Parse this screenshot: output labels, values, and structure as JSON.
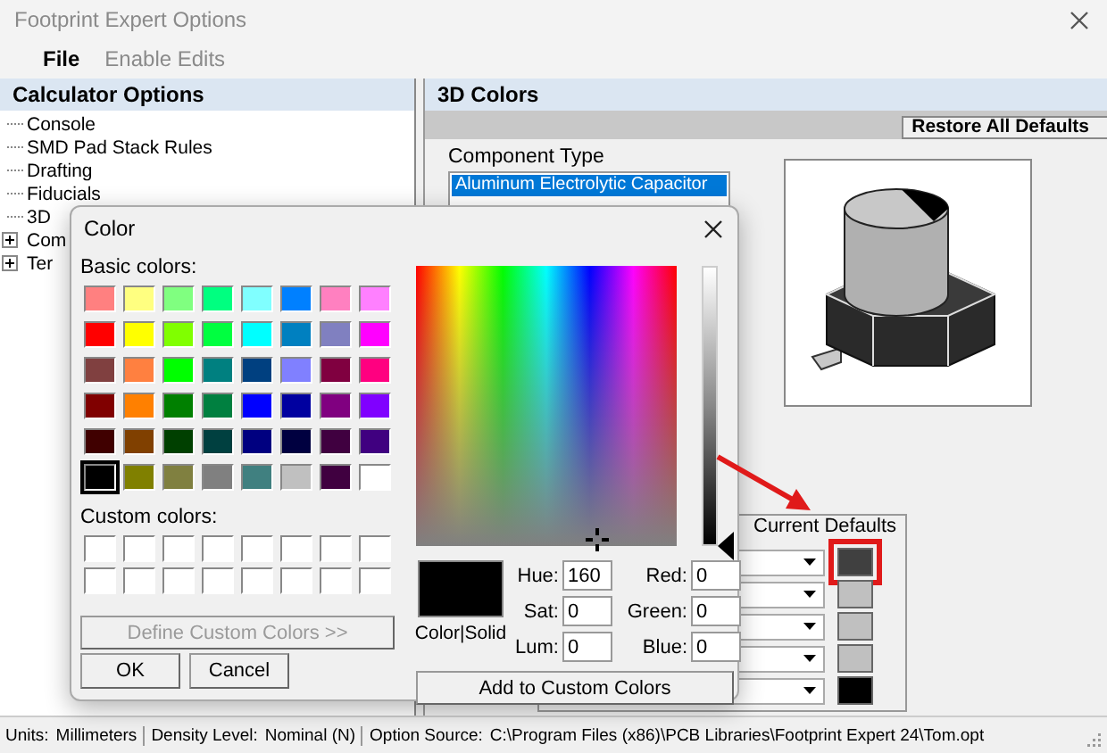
{
  "window": {
    "title": "Footprint Expert Options"
  },
  "menu": [
    {
      "label": "File",
      "disabled": false
    },
    {
      "label": "Enable Edits",
      "disabled": true
    }
  ],
  "sidebar": {
    "title": "Calculator Options",
    "items": [
      {
        "label": "Console",
        "kind": "leaf"
      },
      {
        "label": "SMD Pad Stack Rules",
        "kind": "leaf"
      },
      {
        "label": "Drafting",
        "kind": "leaf"
      },
      {
        "label": "Fiducials",
        "kind": "leaf"
      },
      {
        "label": "3D",
        "kind": "leaf"
      },
      {
        "label": "Com",
        "kind": "node"
      },
      {
        "label": "Ter",
        "kind": "node"
      }
    ]
  },
  "panel": {
    "title": "3D Colors",
    "restore_button": "Restore All Defaults",
    "component_type": {
      "label": "Component Type",
      "items": [
        {
          "label": "Aluminum Electrolytic Capacitor",
          "selected": true
        }
      ]
    },
    "color_table": {
      "columns": [
        "Current",
        "Defaults"
      ],
      "rows": [
        {
          "color": "#404040",
          "highlighted": true
        },
        {
          "color": "#c0c0c0",
          "highlighted": false
        },
        {
          "color": "#c0c0c0",
          "highlighted": false
        },
        {
          "color": "#c0c0c0",
          "highlighted": false
        },
        {
          "color": "#000000",
          "highlighted": false
        }
      ]
    }
  },
  "dialog": {
    "title": "Color",
    "basic_label": "Basic colors:",
    "basic_colors": [
      {
        "color": "#ff8080",
        "selected": false
      },
      {
        "color": "#ffff80",
        "selected": false
      },
      {
        "color": "#80ff80",
        "selected": false
      },
      {
        "color": "#00ff80",
        "selected": false
      },
      {
        "color": "#80ffff",
        "selected": false
      },
      {
        "color": "#0080ff",
        "selected": false
      },
      {
        "color": "#ff80c0",
        "selected": false
      },
      {
        "color": "#ff80ff",
        "selected": false
      },
      {
        "color": "#ff0000",
        "selected": false
      },
      {
        "color": "#ffff00",
        "selected": false
      },
      {
        "color": "#80ff00",
        "selected": false
      },
      {
        "color": "#00ff40",
        "selected": false
      },
      {
        "color": "#00ffff",
        "selected": false
      },
      {
        "color": "#0080c0",
        "selected": false
      },
      {
        "color": "#8080c0",
        "selected": false
      },
      {
        "color": "#ff00ff",
        "selected": false
      },
      {
        "color": "#804040",
        "selected": false
      },
      {
        "color": "#ff8040",
        "selected": false
      },
      {
        "color": "#00ff00",
        "selected": false
      },
      {
        "color": "#008080",
        "selected": false
      },
      {
        "color": "#004080",
        "selected": false
      },
      {
        "color": "#8080ff",
        "selected": false
      },
      {
        "color": "#800040",
        "selected": false
      },
      {
        "color": "#ff0080",
        "selected": false
      },
      {
        "color": "#800000",
        "selected": false
      },
      {
        "color": "#ff8000",
        "selected": false
      },
      {
        "color": "#008000",
        "selected": false
      },
      {
        "color": "#008040",
        "selected": false
      },
      {
        "color": "#0000ff",
        "selected": false
      },
      {
        "color": "#0000a0",
        "selected": false
      },
      {
        "color": "#800080",
        "selected": false
      },
      {
        "color": "#8000ff",
        "selected": false
      },
      {
        "color": "#400000",
        "selected": false
      },
      {
        "color": "#804000",
        "selected": false
      },
      {
        "color": "#004000",
        "selected": false
      },
      {
        "color": "#004040",
        "selected": false
      },
      {
        "color": "#000080",
        "selected": false
      },
      {
        "color": "#000040",
        "selected": false
      },
      {
        "color": "#400040",
        "selected": false
      },
      {
        "color": "#400080",
        "selected": false
      },
      {
        "color": "#000000",
        "selected": true
      },
      {
        "color": "#808000",
        "selected": false
      },
      {
        "color": "#808040",
        "selected": false
      },
      {
        "color": "#808080",
        "selected": false
      },
      {
        "color": "#408080",
        "selected": false
      },
      {
        "color": "#c0c0c0",
        "selected": false
      },
      {
        "color": "#400040",
        "selected": false
      },
      {
        "color": "#ffffff",
        "selected": false
      }
    ],
    "custom_label": "Custom colors:",
    "custom_colors": [
      {
        "color": "#ffffff"
      },
      {
        "color": "#ffffff"
      },
      {
        "color": "#ffffff"
      },
      {
        "color": "#ffffff"
      },
      {
        "color": "#ffffff"
      },
      {
        "color": "#ffffff"
      },
      {
        "color": "#ffffff"
      },
      {
        "color": "#ffffff"
      },
      {
        "color": "#ffffff"
      },
      {
        "color": "#ffffff"
      },
      {
        "color": "#ffffff"
      },
      {
        "color": "#ffffff"
      },
      {
        "color": "#ffffff"
      },
      {
        "color": "#ffffff"
      },
      {
        "color": "#ffffff"
      },
      {
        "color": "#ffffff"
      }
    ],
    "define_button": {
      "label": "Define Custom Colors >>",
      "disabled": true
    },
    "ok_button": "OK",
    "cancel_button": "Cancel",
    "luminance": {
      "level": 0
    },
    "preview": {
      "color": "#000000",
      "label": "Color|Solid"
    },
    "fields": [
      {
        "label": "Hue:",
        "value": "160"
      },
      {
        "label": "Red:",
        "value": "0"
      },
      {
        "label": "Sat:",
        "value": "0"
      },
      {
        "label": "Green:",
        "value": "0"
      },
      {
        "label": "Lum:",
        "value": "0"
      },
      {
        "label": "Blue:",
        "value": "0"
      }
    ],
    "add_button": "Add to Custom Colors"
  },
  "status_bar": [
    {
      "label": "Units:",
      "value": "Millimeters"
    },
    {
      "label": "Density Level:",
      "value": "Nominal (N)"
    },
    {
      "label": "Option Source:",
      "value": "C:\\Program Files (x86)\\PCB Libraries\\Footprint Expert 24\\Tom.opt"
    }
  ]
}
